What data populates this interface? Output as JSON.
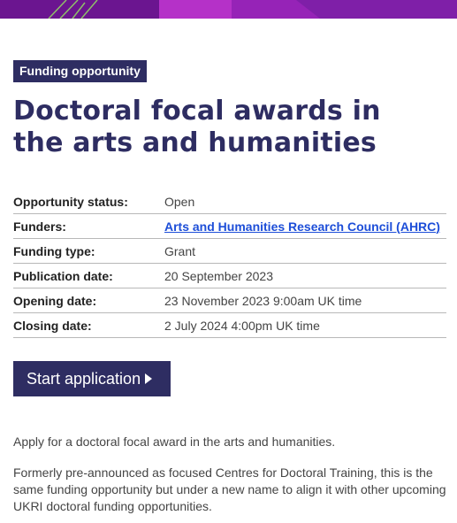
{
  "tag": "Funding opportunity",
  "title": "Doctoral focal awards in the arts and humanities",
  "details": {
    "status_label": "Opportunity status:",
    "status_value": "Open",
    "funders_label": "Funders:",
    "funders_value": "Arts and Humanities Research Council (AHRC)",
    "type_label": "Funding type:",
    "type_value": "Grant",
    "publication_label": "Publication date:",
    "publication_value": "20 September 2023",
    "opening_label": "Opening date:",
    "opening_value": "23 November 2023 9:00am UK time",
    "closing_label": "Closing date:",
    "closing_value": "2 July 2024 4:00pm UK time"
  },
  "button": {
    "label": "Start application",
    "icon": "play-triangle-icon"
  },
  "paragraphs": [
    "Apply for a doctoral focal award in the arts and humanities.",
    "Formerly pre-announced as focused Centres for Doctoral Training, this is the same funding opportunity but under a new name to align it with other upcoming UKRI doctoral funding opportunities."
  ],
  "colors": {
    "brand_navy": "#2e2d62",
    "banner_purple": "#7f1fa8",
    "link_blue": "#1d4ed8"
  }
}
